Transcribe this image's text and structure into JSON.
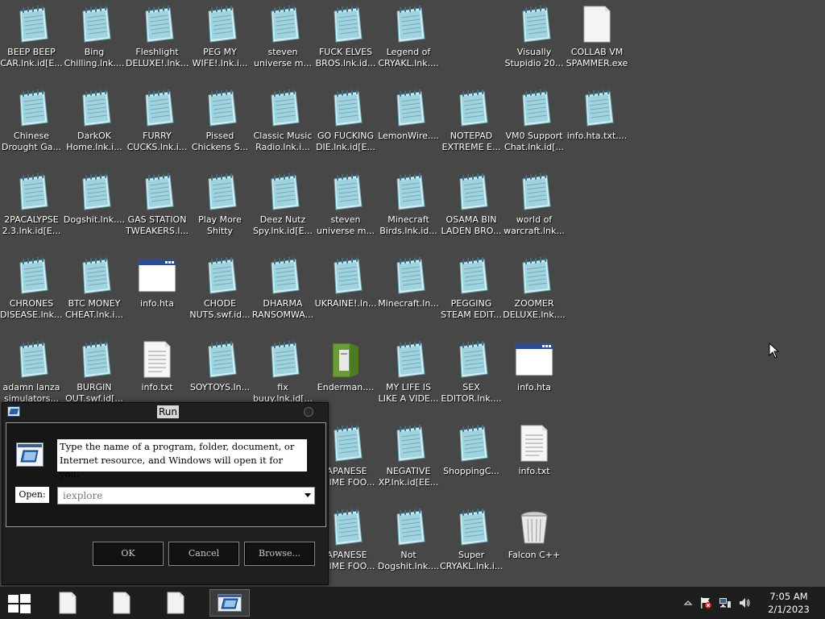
{
  "desktop": {
    "icons": [
      {
        "label": "BEEP BEEP\nCAR.lnk.id[E...",
        "type": "notepad"
      },
      {
        "label": "Bing\nChilling.lnk....",
        "type": "notepad"
      },
      {
        "label": "Fleshlight\nDELUXE!.lnk....",
        "type": "notepad"
      },
      {
        "label": "PEG MY\nWIFE!.lnk.i...",
        "type": "notepad"
      },
      {
        "label": "steven\nuniverse m...",
        "type": "notepad"
      },
      {
        "label": "FUCK ELVES\nBROS.lnk.id...",
        "type": "notepad"
      },
      {
        "label": "Legend of\nCRYAKL.lnk....",
        "type": "notepad"
      },
      {
        "label": "Visually\nStupidio 20...",
        "type": "notepad"
      },
      {
        "label": "COLLAB VM\nSPAMMER.exe",
        "type": "blank"
      },
      {
        "label": "Chinese\nDrought Ga...",
        "type": "notepad"
      },
      {
        "label": "DarkOK\nHome.lnk.i...",
        "type": "notepad"
      },
      {
        "label": "FURRY\nCUCKS.lnk.i...",
        "type": "notepad"
      },
      {
        "label": "Pissed\nChickens S...",
        "type": "notepad"
      },
      {
        "label": "Classic Music\nRadio.lnk.i...",
        "type": "notepad"
      },
      {
        "label": "GO FUCKING\nDIE.lnk.id[E...",
        "type": "notepad"
      },
      {
        "label": "LemonWire....",
        "type": "notepad"
      },
      {
        "label": "NOTEPAD\nEXTREME E...",
        "type": "notepad"
      },
      {
        "label": "VM0 Support\nChat.lnk.id[...",
        "type": "notepad"
      },
      {
        "label": "info.hta.txt....",
        "type": "notepad"
      },
      {
        "label": "2PACALYPSE\n2.3.lnk.id[E...",
        "type": "notepad"
      },
      {
        "label": "Dogshit.lnk....",
        "type": "notepad"
      },
      {
        "label": "GAS STATION\nTWEAKERS.l...",
        "type": "notepad"
      },
      {
        "label": "Play More\nShitty Game...",
        "type": "notepad"
      },
      {
        "label": "Deez Nutz\nSpy.lnk.id[E...",
        "type": "notepad"
      },
      {
        "label": "steven\nuniverse m...",
        "type": "notepad"
      },
      {
        "label": "Minecraft\nBirds.lnk.id...",
        "type": "notepad"
      },
      {
        "label": "OSAMA BIN\nLADEN BRO...",
        "type": "notepad"
      },
      {
        "label": "world of\nwarcraft.lnk...",
        "type": "notepad"
      },
      {
        "label": "CHRONES\nDISEASE.lnk....",
        "type": "notepad"
      },
      {
        "label": "BTC MONEY\nCHEAT.lnk.i...",
        "type": "notepad"
      },
      {
        "label": "info.hta",
        "type": "window"
      },
      {
        "label": "CHODE\nNUTS.swf.id...",
        "type": "notepad"
      },
      {
        "label": "DHARMA\nRANSOMWA...",
        "type": "notepad"
      },
      {
        "label": "UKRAINE!.ln...",
        "type": "notepad"
      },
      {
        "label": "Minecraft.ln...",
        "type": "notepad"
      },
      {
        "label": "PEGGING\nSTEAM EDIT...",
        "type": "notepad"
      },
      {
        "label": "ZOOMER\nDELUXE.lnk....",
        "type": "notepad"
      },
      {
        "label": "adamn lanza\nsimulators...",
        "type": "notepad"
      },
      {
        "label": "BURGIN\nOUT.swf.id[...",
        "type": "notepad"
      },
      {
        "label": "info.txt",
        "type": "text"
      },
      {
        "label": "SOYTOYS.ln...",
        "type": "notepad"
      },
      {
        "label": "fix\nbuuy.lnk.id[...",
        "type": "notepad"
      },
      {
        "label": "Enderman....",
        "type": "green"
      },
      {
        "label": "MY LIFE IS\nLIKE A VIDE...",
        "type": "notepad"
      },
      {
        "label": "SEX\nEDITOR.lnk....",
        "type": "notepad"
      },
      {
        "label": "info.hta",
        "type": "window"
      },
      {
        "label": "JAPANESE\nANIME FOO...",
        "type": "notepad"
      },
      {
        "label": "NEGATIVE\nXP.lnk.id[EE...",
        "type": "notepad"
      },
      {
        "label": "ShoppingC...",
        "type": "notepad"
      },
      {
        "label": "info.txt",
        "type": "text"
      },
      {
        "label": "JAPANESE\nANIME FOO...",
        "type": "notepad"
      },
      {
        "label": "Not\nDogshit.lnk....",
        "type": "notepad"
      },
      {
        "label": "Super\nCRYAKL.lnk.i...",
        "type": "notepad"
      },
      {
        "label": "Falcon C++",
        "type": "recycle"
      }
    ]
  },
  "run_dialog": {
    "title": "Run",
    "description": "Type the name of a program, folder, document, or Internet resource, and Windows will open it for you.",
    "open_label": "Open:",
    "open_value": "iexplore",
    "ok_label": "OK",
    "cancel_label": "Cancel",
    "browse_label": "Browse..."
  },
  "taskbar": {
    "start_icon": "windows-logo-icon",
    "items": [
      {
        "icon": "document-icon",
        "active": false
      },
      {
        "icon": "document-icon",
        "active": false
      },
      {
        "icon": "document-icon",
        "active": false
      },
      {
        "icon": "run-app-icon",
        "active": true
      }
    ],
    "tray": [
      "chevron-up-icon",
      "action-center-flag-icon",
      "network-icon",
      "volume-icon"
    ],
    "time": "7:05 AM",
    "date": "2/1/2023"
  },
  "colors": {
    "desktop_bg": "#474747",
    "taskbar_bg": "#1e1e1e",
    "dialog_bg": "#1f1f1f"
  }
}
